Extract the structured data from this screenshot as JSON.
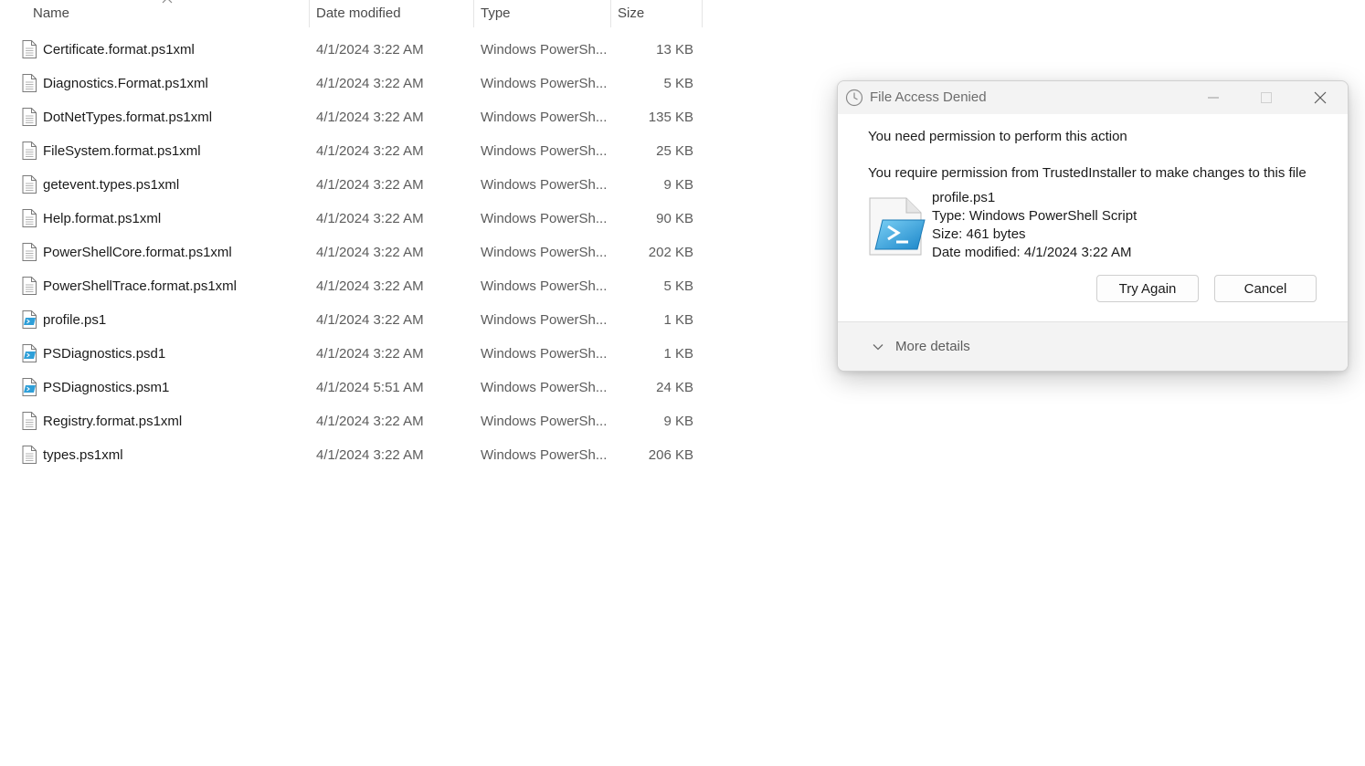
{
  "columns": {
    "name": "Name",
    "date": "Date modified",
    "type": "Type",
    "size": "Size"
  },
  "files": [
    {
      "name": "Certificate.format.ps1xml",
      "date": "4/1/2024 3:22 AM",
      "type": "Windows PowerSh...",
      "size": "13 KB",
      "icon": "document-icon"
    },
    {
      "name": "Diagnostics.Format.ps1xml",
      "date": "4/1/2024 3:22 AM",
      "type": "Windows PowerSh...",
      "size": "5 KB",
      "icon": "document-icon"
    },
    {
      "name": "DotNetTypes.format.ps1xml",
      "date": "4/1/2024 3:22 AM",
      "type": "Windows PowerSh...",
      "size": "135 KB",
      "icon": "document-icon"
    },
    {
      "name": "FileSystem.format.ps1xml",
      "date": "4/1/2024 3:22 AM",
      "type": "Windows PowerSh...",
      "size": "25 KB",
      "icon": "document-icon"
    },
    {
      "name": "getevent.types.ps1xml",
      "date": "4/1/2024 3:22 AM",
      "type": "Windows PowerSh...",
      "size": "9 KB",
      "icon": "document-icon"
    },
    {
      "name": "Help.format.ps1xml",
      "date": "4/1/2024 3:22 AM",
      "type": "Windows PowerSh...",
      "size": "90 KB",
      "icon": "document-icon"
    },
    {
      "name": "PowerShellCore.format.ps1xml",
      "date": "4/1/2024 3:22 AM",
      "type": "Windows PowerSh...",
      "size": "202 KB",
      "icon": "document-icon"
    },
    {
      "name": "PowerShellTrace.format.ps1xml",
      "date": "4/1/2024 3:22 AM",
      "type": "Windows PowerSh...",
      "size": "5 KB",
      "icon": "document-icon"
    },
    {
      "name": "profile.ps1",
      "date": "4/1/2024 3:22 AM",
      "type": "Windows PowerSh...",
      "size": "1 KB",
      "icon": "powershell-script-icon"
    },
    {
      "name": "PSDiagnostics.psd1",
      "date": "4/1/2024 3:22 AM",
      "type": "Windows PowerSh...",
      "size": "1 KB",
      "icon": "powershell-script-icon"
    },
    {
      "name": "PSDiagnostics.psm1",
      "date": "4/1/2024 5:51 AM",
      "type": "Windows PowerSh...",
      "size": "24 KB",
      "icon": "powershell-script-icon"
    },
    {
      "name": "Registry.format.ps1xml",
      "date": "4/1/2024 3:22 AM",
      "type": "Windows PowerSh...",
      "size": "9 KB",
      "icon": "document-icon"
    },
    {
      "name": "types.ps1xml",
      "date": "4/1/2024 3:22 AM",
      "type": "Windows PowerSh...",
      "size": "206 KB",
      "icon": "document-icon"
    }
  ],
  "dialog": {
    "title": "File Access Denied",
    "message": "You need permission to perform this action",
    "sub_message": "You require permission from TrustedInstaller to make changes to this file",
    "file": {
      "name": "profile.ps1",
      "type": "Type: Windows PowerShell Script",
      "size": "Size: 461 bytes",
      "date": "Date modified: 4/1/2024 3:22 AM"
    },
    "try_again_label": "Try Again",
    "cancel_label": "Cancel",
    "more_details_label": "More details"
  },
  "colors": {
    "dialog_bg": "#f3f3f3",
    "powershell_blue": "#2f9fd8",
    "text_secondary": "#5c5c5c"
  }
}
